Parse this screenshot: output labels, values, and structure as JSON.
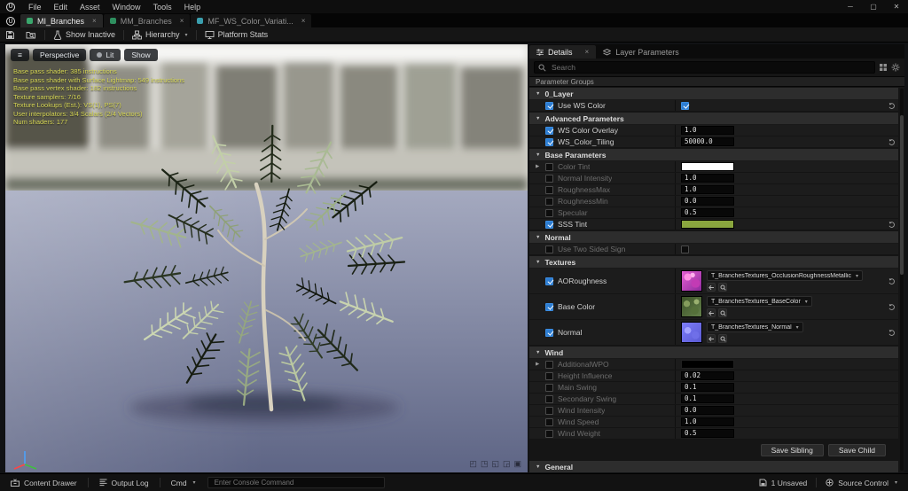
{
  "icons": {
    "caret": "▾",
    "close": "×",
    "expander_closed": "▶",
    "expander_open": "▼",
    "minimize": "─",
    "maximize": "▢",
    "close_win": "✕",
    "logo": "U"
  },
  "menubar": {
    "items": [
      "File",
      "Edit",
      "Asset",
      "Window",
      "Tools",
      "Help"
    ]
  },
  "tabs": {
    "items": [
      {
        "label": "MI_Branches",
        "active": true
      },
      {
        "label": "MM_Branches",
        "active": false
      },
      {
        "label": "MF_WS_Color_Variati...",
        "active": false
      }
    ]
  },
  "toolbar": {
    "show_inactive": "Show Inactive",
    "hierarchy": "Hierarchy",
    "platform_stats": "Platform Stats"
  },
  "viewport": {
    "buttons": {
      "perspective": "Perspective",
      "lit": "Lit",
      "show": "Show"
    },
    "stats": [
      "Base pass shader: 385 instructions",
      "Base pass shader with Surface Lightmap: 549 instructions",
      "Base pass vertex shader: 182 instructions",
      "Texture samplers: 7/16",
      "Texture Lookups (Est.): VS(1), PS(7)",
      "User interpolators: 3/4 Scalars (2/4 Vectors)",
      "Num shaders: 177"
    ],
    "nav_icons": [
      "◰",
      "◳",
      "◱",
      "◲",
      "▣"
    ]
  },
  "details": {
    "tabs": {
      "details": "Details",
      "layer_parameters": "Layer Parameters"
    },
    "search_placeholder": "Search",
    "header": "Parameter Groups",
    "accent_color": "#2d7dd2",
    "groups": [
      {
        "name": "0_Layer",
        "rows": [
          {
            "label": "Use WS Color",
            "type": "bool",
            "value": true
          }
        ]
      },
      {
        "name": "Advanced Parameters",
        "rows": [
          {
            "label": "WS Color Overlay",
            "type": "number",
            "value": "1.0"
          },
          {
            "label": "WS_Color_Tiling",
            "type": "number",
            "value": "50000.0"
          }
        ]
      },
      {
        "name": "Base Parameters",
        "rows": [
          {
            "label": "Color Tint",
            "type": "color",
            "color": "#ffffff"
          },
          {
            "label": "Normal Intensity",
            "type": "number",
            "value": "1.0"
          },
          {
            "label": "RoughnessMax",
            "type": "number",
            "value": "1.0"
          },
          {
            "label": "RoughnessMin",
            "type": "number",
            "value": "0.0"
          },
          {
            "label": "Specular",
            "type": "number",
            "value": "0.5"
          },
          {
            "label": "SSS Tint",
            "type": "color",
            "color": "#8aa63e"
          }
        ]
      },
      {
        "name": "Normal",
        "rows": [
          {
            "label": "Use Two Sided Sign",
            "type": "bool",
            "value": false
          }
        ]
      },
      {
        "name": "Textures",
        "rows": [
          {
            "label": "AORoughness",
            "type": "texture",
            "asset": "T_BranchesTextures_OcclusionRoughnessMetallic"
          },
          {
            "label": "Base Color",
            "type": "texture",
            "asset": "T_BranchesTextures_BaseColor"
          },
          {
            "label": "Normal",
            "type": "texture",
            "asset": "T_BranchesTextures_Normal"
          }
        ]
      },
      {
        "name": "Wind",
        "rows": [
          {
            "label": "AdditionalWPO",
            "type": "vector"
          },
          {
            "label": "Height Influence",
            "type": "number",
            "value": "0.02"
          },
          {
            "label": "Main Swing",
            "type": "number",
            "value": "0.1"
          },
          {
            "label": "Secondary Swing",
            "type": "number",
            "value": "0.1"
          },
          {
            "label": "Wind Intensity",
            "type": "number",
            "value": "0.0"
          },
          {
            "label": "Wind Speed",
            "type": "number",
            "value": "1.0"
          },
          {
            "label": "Wind Weight",
            "type": "number",
            "value": "0.5"
          }
        ]
      }
    ],
    "buttons": {
      "save_sibling": "Save Sibling",
      "save_child": "Save Child"
    },
    "general_header": "General"
  },
  "statusbar": {
    "content_drawer": "Content Drawer",
    "output_log": "Output Log",
    "cmd": "Cmd",
    "console_placeholder": "Enter Console Command",
    "unsaved": "1 Unsaved",
    "source_control": "Source Control"
  }
}
